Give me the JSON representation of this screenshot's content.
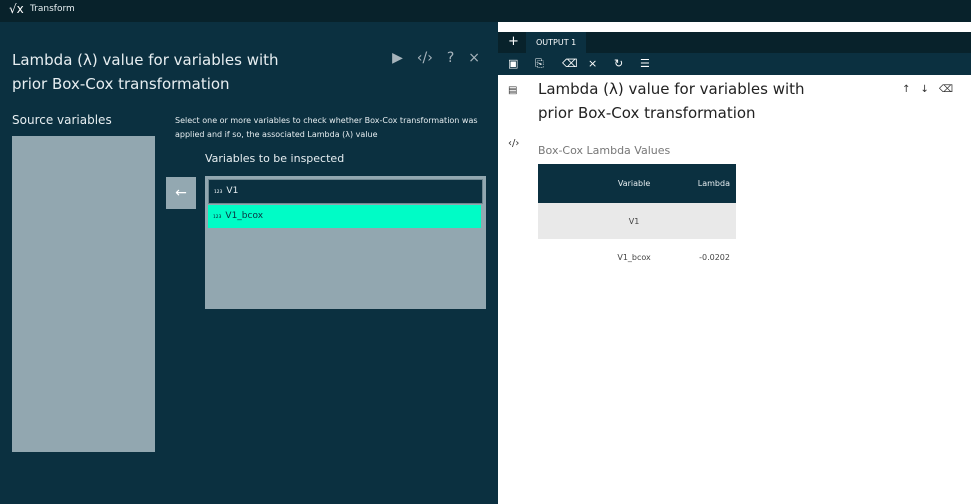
{
  "app": {
    "title": "Transform"
  },
  "dialog": {
    "heading": "Lambda (λ) value for variables with prior Box-Cox transformation",
    "tools": {
      "run": "▶",
      "code": "‹/›",
      "help": "?",
      "close": "×"
    },
    "source_label": "Source variables",
    "description": "Select one or more variables to check whether Box-Cox transformation was applied and if so, the associated Lambda (λ) value",
    "vars_label": "Variables to be inspected",
    "arrow": "←",
    "variables": [
      {
        "icon": "₁₂₃",
        "name": "V1"
      },
      {
        "icon": "₁₂₃",
        "name": "V1_bcox"
      }
    ]
  },
  "output": {
    "tab_label": "OUTPUT 1",
    "add": "+",
    "title": "Lambda (λ) value for variables with prior Box-Cox transformation",
    "subtitle": "Box-Cox Lambda Values",
    "table": {
      "headers": [
        "",
        "Variable",
        "Lambda"
      ],
      "rows": [
        {
          "variable": "V1",
          "lambda": ""
        },
        {
          "variable": "V1_bcox",
          "lambda": "-0.0202"
        }
      ]
    }
  }
}
